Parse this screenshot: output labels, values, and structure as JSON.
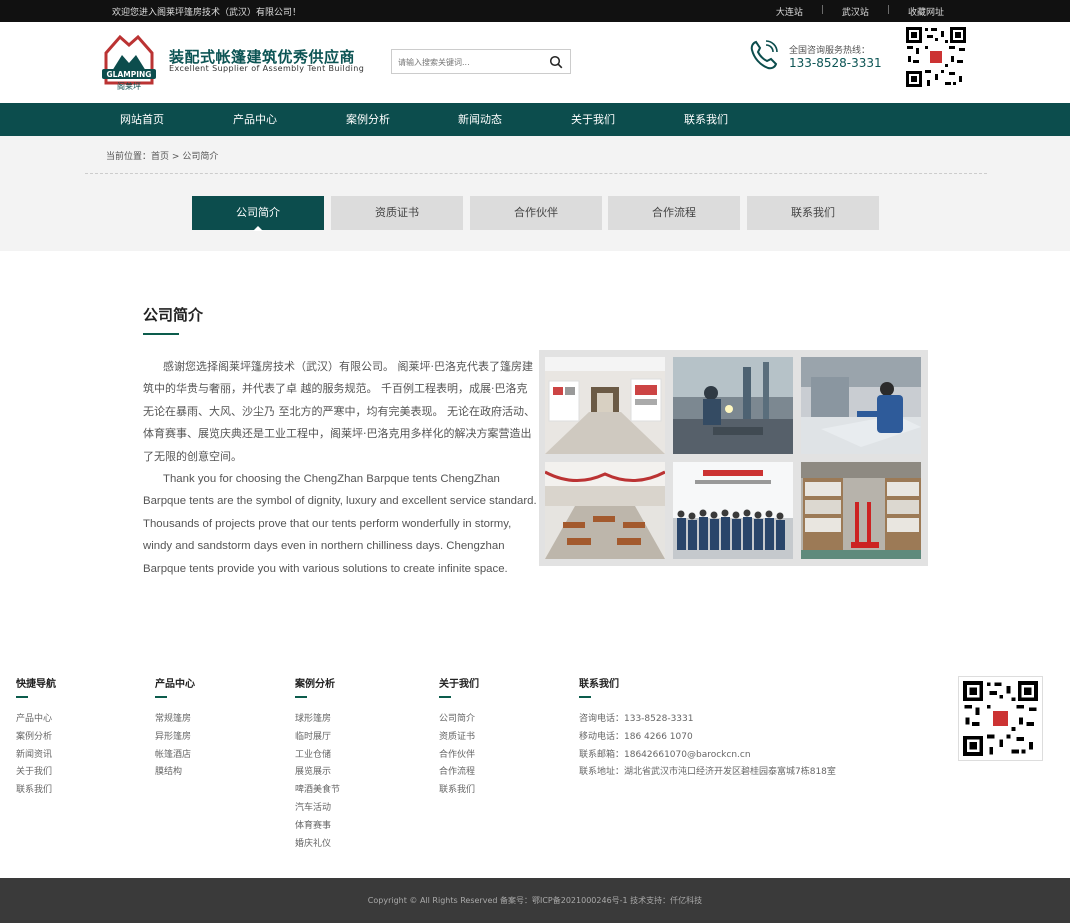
{
  "topbar": {
    "welcome": "欢迎您进入阁莱坪篷房技术（武汉）有限公司！",
    "links": [
      "大连站",
      "武汉站",
      "收藏网址"
    ]
  },
  "header": {
    "logo_text": "GLAMPING",
    "logo_sub": "阁莱坪",
    "brand_cn": "装配式帐篷建筑优秀供应商",
    "brand_en": "Excellent Supplier of Assembly Tent Building",
    "search_placeholder": "请输入搜索关键词...",
    "hotline_label": "全国咨询服务热线：",
    "hotline_number": "133-8528-3331"
  },
  "nav": [
    "网站首页",
    "产品中心",
    "案例分析",
    "新闻动态",
    "关于我们",
    "联系我们"
  ],
  "breadcrumb": {
    "prefix": "当前位置：",
    "home": "首页",
    "sep": ">",
    "current": "公司简介"
  },
  "tabs": [
    {
      "label": "公司简介",
      "active": true
    },
    {
      "label": "资质证书",
      "active": false
    },
    {
      "label": "合作伙伴",
      "active": false
    },
    {
      "label": "合作流程",
      "active": false
    },
    {
      "label": "联系我们",
      "active": false
    }
  ],
  "content": {
    "title": "公司简介",
    "para_cn": "感谢您选择阁莱坪篷房技术（武汉）有限公司。 阁莱坪·巴洛克代表了篷房建筑中的华贵与奢丽，并代表了卓 越的服务规范。 千百例工程表明，成展·巴洛克无论在暴雨、大风、沙尘乃 至北方的严寒中，均有完美表现。 无论在政府活动、体育赛事、展览庆典还是工业工程中，阁莱坪·巴洛克用多样化的解决方案营造出了无限的创意空间。",
    "para_en": "Thank you for choosing the ChengZhan Barpque tents ChengZhan Barpque tents are the symbol of dignity, luxury and excellent service standard. Thousands of projects prove that our tents perform wonderfully in stormy, windy and sandstorm days even in northern chilliness days. Chengzhan Barpque tents provide you with various solutions to create infinite space."
  },
  "footer": {
    "columns": [
      {
        "title": "快捷导航",
        "items": [
          "产品中心",
          "案例分析",
          "新闻资讯",
          "关于我们",
          "联系我们"
        ]
      },
      {
        "title": "产品中心",
        "items": [
          "常规篷房",
          "异形篷房",
          "帐篷酒店",
          "膜结构"
        ]
      },
      {
        "title": "案例分析",
        "items": [
          "球形篷房",
          "临时展厅",
          "工业仓储",
          "展览展示",
          "啤酒美食节",
          "汽车活动",
          "体育赛事",
          "婚庆礼仪"
        ]
      },
      {
        "title": "关于我们",
        "items": [
          "公司简介",
          "资质证书",
          "合作伙伴",
          "合作流程",
          "联系我们"
        ]
      },
      {
        "title": "联系我们",
        "items": [
          "咨询电话：133-8528-3331",
          "移动电话：186 4266 1070",
          "联系邮箱：18642661070@barockcn.cn",
          "联系地址：湖北省武汉市沌口经济开发区碧桂园泰富城7栋818室"
        ]
      }
    ],
    "copyright": "Copyright © All Rights Reserved 备案号：鄂ICP备2021000246号-1 技术支持：仟亿科技"
  },
  "colors": {
    "brand_green": "#0c4d4d",
    "topbar_bg": "#111111",
    "footer_bar_bg": "#3a3a3a"
  }
}
